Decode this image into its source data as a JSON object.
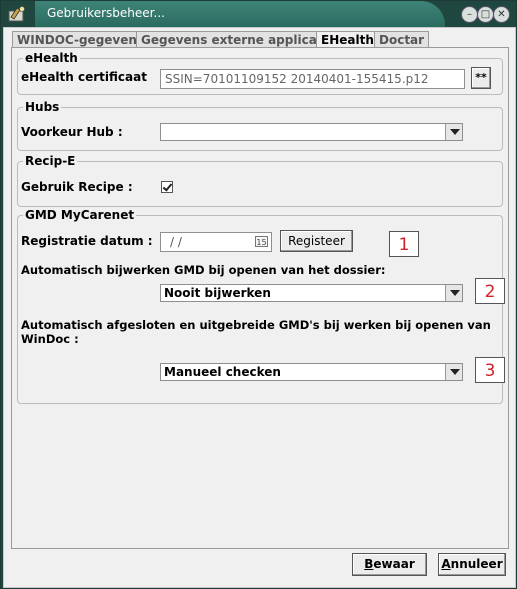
{
  "window": {
    "title": "Gebruikersbeheer..."
  },
  "tabs": [
    "WINDOC-gegevens",
    "Gegevens externe applicaties",
    "EHealth",
    "Doctar"
  ],
  "ehealth": {
    "legend": "eHealth",
    "certificate_label": "eHealth certificaat",
    "certificate_value": "SSIN=70101109152 20140401-155415.p12",
    "browse_label": "**"
  },
  "hubs": {
    "legend": "Hubs",
    "preferred_label": "Voorkeur Hub :",
    "preferred_value": ""
  },
  "recipe": {
    "legend": "Recip-E",
    "use_label": "Gebruik Recipe :",
    "use_checked": true
  },
  "gmd": {
    "legend": "GMD MyCarenet",
    "registration_label": "Registratie datum :",
    "registration_value": "/ /",
    "register_button": "Registeer",
    "auto_update_label": "Automatisch bijwerken GMD bij openen van het dossier:",
    "auto_update_value": "Nooit bijwerken",
    "auto_closed_label_line1": "Automatisch afgesloten en uitgebreide GMD's bij werken bij openen van",
    "auto_closed_label_line2": "WinDoc :",
    "auto_closed_value": "Manueel checken"
  },
  "annotations": [
    "1",
    "2",
    "3"
  ],
  "footer": {
    "save_prefix": "B",
    "save_rest": "ewaar",
    "cancel_prefix": "A",
    "cancel_rest": "nnuleer"
  },
  "colors": {
    "titlebar": "#1f4740",
    "title_tab": "#3f8478",
    "annotation": "#d0202a"
  }
}
